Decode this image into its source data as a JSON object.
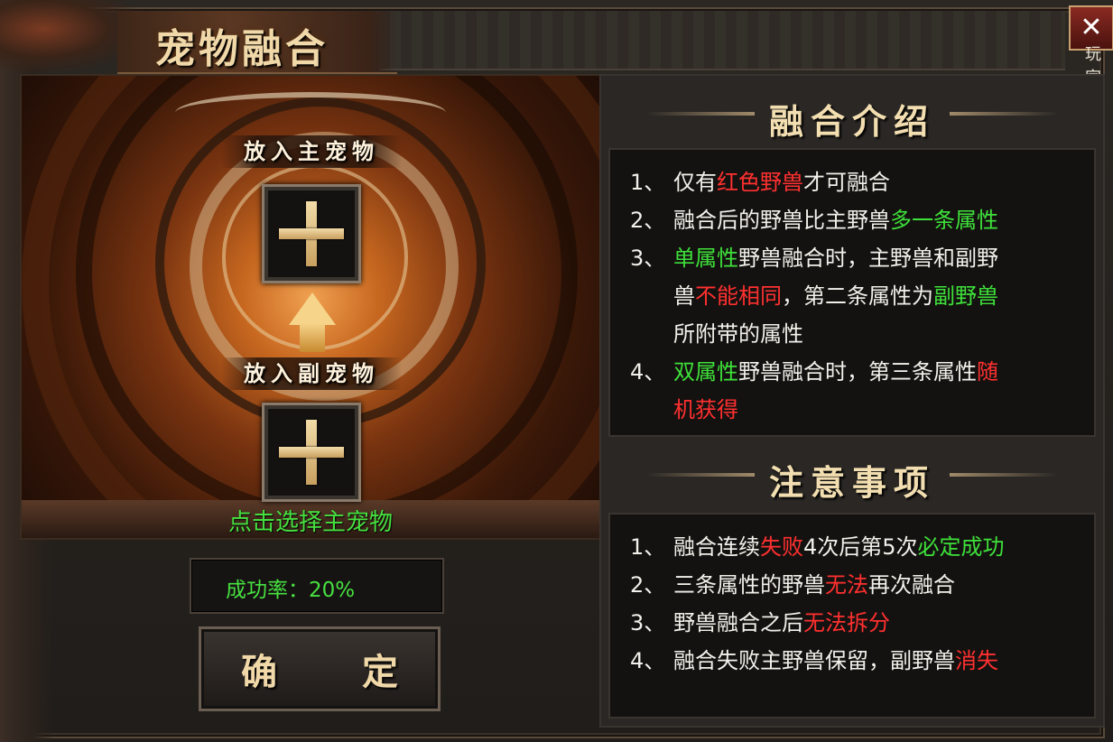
{
  "window": {
    "title": "宠物融合",
    "close_label": "✕",
    "corner_label": "玩家"
  },
  "left": {
    "main_slot_label": "放入主宠物",
    "sub_slot_label": "放入副宠物",
    "hint": "点击选择主宠物",
    "success_rate": "成功率：20%",
    "confirm_label": "确  定"
  },
  "intro": {
    "title": "融合介绍",
    "lines": [
      {
        "num": "1、",
        "parts": [
          [
            "仅有",
            ""
          ],
          [
            "红色野兽",
            "red"
          ],
          [
            "才可融合",
            ""
          ]
        ]
      },
      {
        "num": "2、",
        "parts": [
          [
            "融合后的野兽比主野兽",
            ""
          ],
          [
            "多一条属性",
            "green"
          ]
        ]
      },
      {
        "num": "3、",
        "parts": [
          [
            "单属性",
            "green"
          ],
          [
            "野兽融合时，主野兽和副野",
            ""
          ]
        ]
      },
      {
        "num": "",
        "parts": [
          [
            "兽",
            ""
          ],
          [
            "不能相同",
            "red"
          ],
          [
            "，第二条属性为",
            ""
          ],
          [
            "副野兽",
            "green"
          ]
        ]
      },
      {
        "num": "",
        "parts": [
          [
            "所附带的属性",
            ""
          ]
        ]
      },
      {
        "num": "4、",
        "parts": [
          [
            "双属性",
            "green"
          ],
          [
            "野兽融合时，第三条属性",
            ""
          ],
          [
            "随",
            "red"
          ]
        ]
      },
      {
        "num": "",
        "parts": [
          [
            "机获得",
            "red"
          ]
        ]
      }
    ]
  },
  "notes": {
    "title": "注意事项",
    "lines": [
      {
        "num": "1、",
        "parts": [
          [
            "融合连续",
            ""
          ],
          [
            "失败",
            "red"
          ],
          [
            "4次后第5次",
            ""
          ],
          [
            "必定成功",
            "green"
          ]
        ]
      },
      {
        "num": "2、",
        "parts": [
          [
            "三条属性的野兽",
            ""
          ],
          [
            "无法",
            "red"
          ],
          [
            "再次融合",
            ""
          ]
        ]
      },
      {
        "num": "3、",
        "parts": [
          [
            "野兽融合之后",
            ""
          ],
          [
            "无法拆分",
            "red"
          ]
        ]
      },
      {
        "num": "4、",
        "parts": [
          [
            "融合失败主野兽保留，副野兽",
            ""
          ],
          [
            "消失",
            "red"
          ]
        ]
      }
    ]
  },
  "colors": {
    "red": "#ff3030",
    "green": "#3ee03a",
    "title_gold": "#f2deb0"
  }
}
